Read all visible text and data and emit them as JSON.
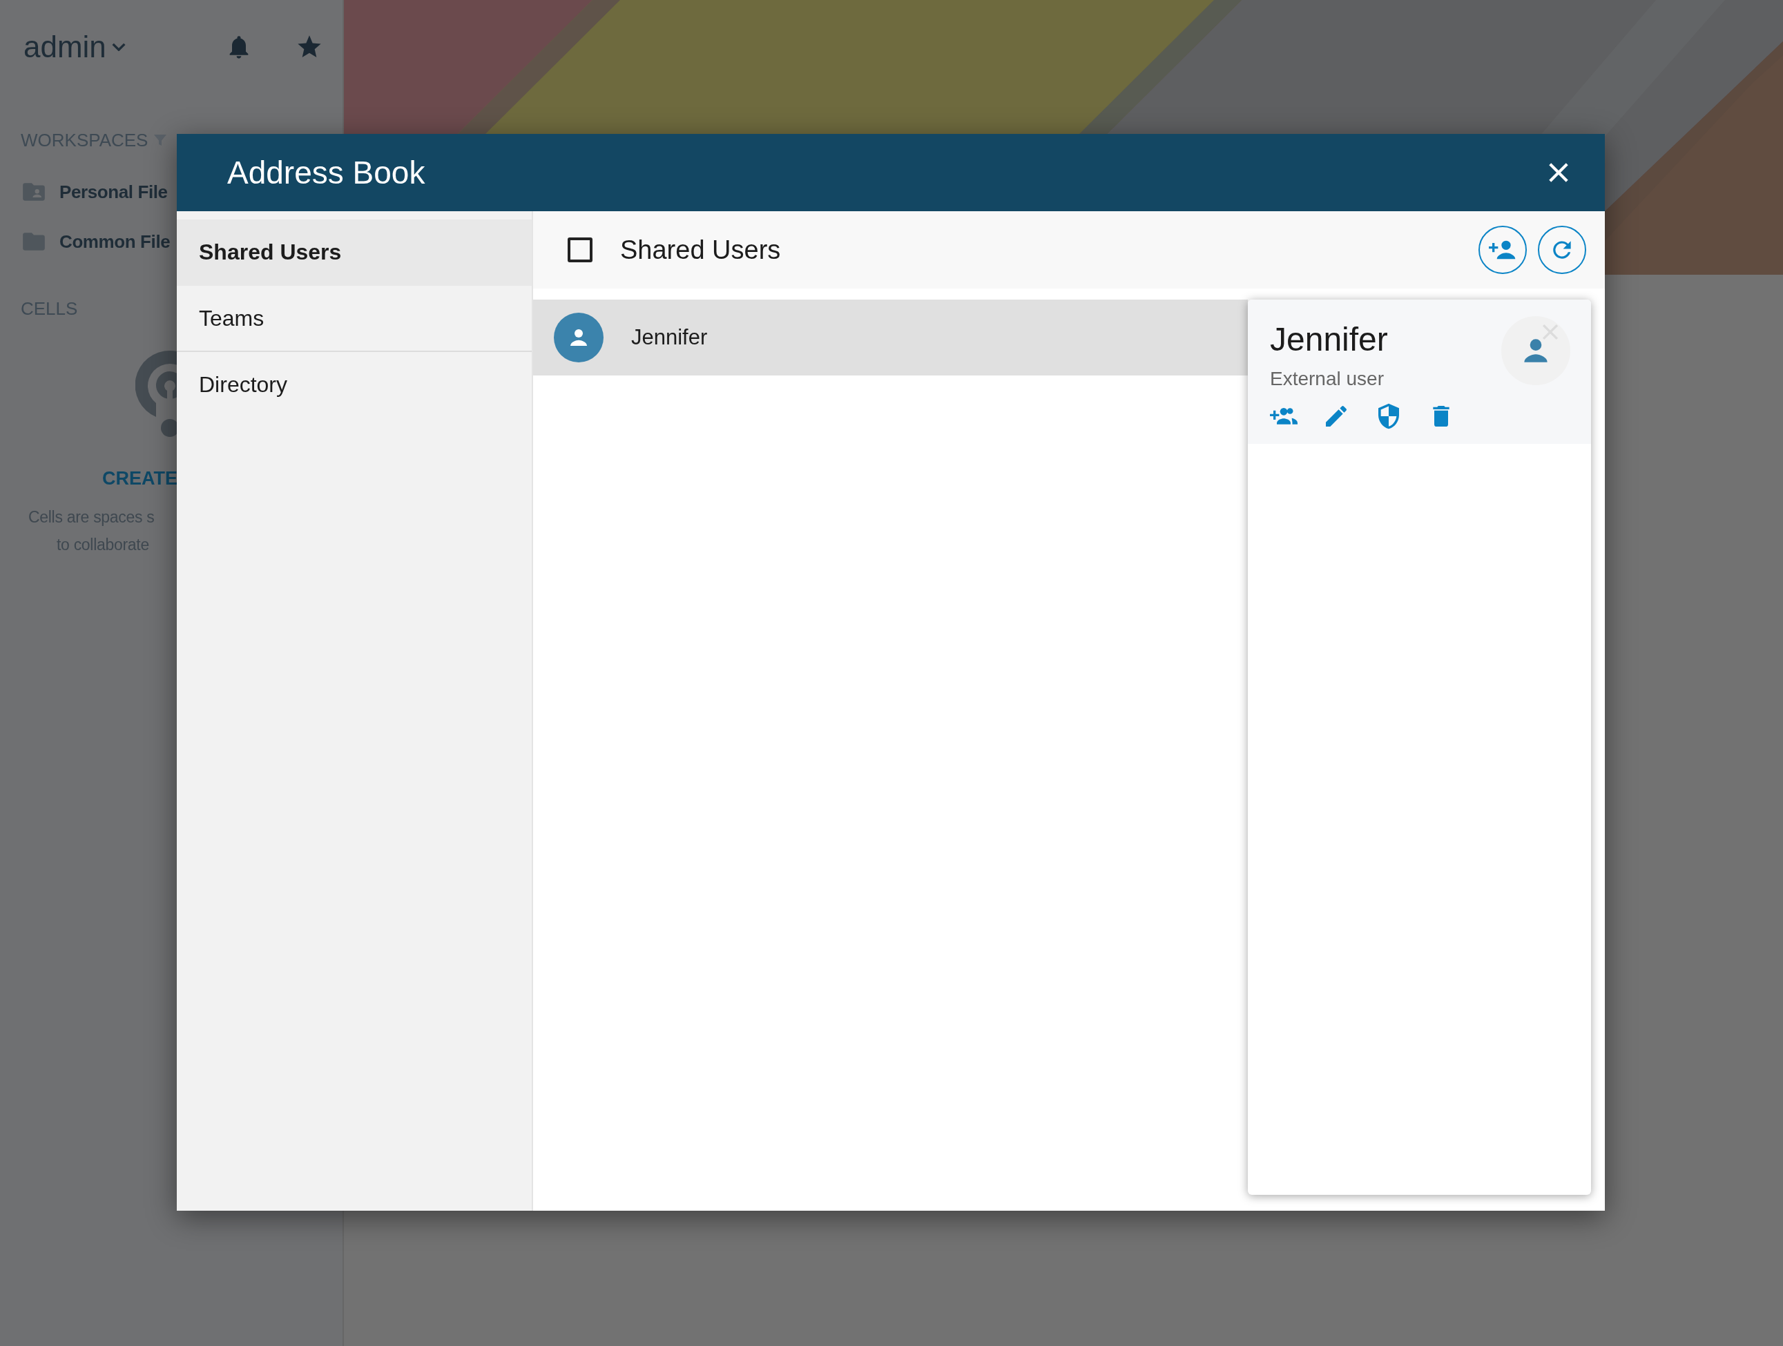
{
  "sidebar": {
    "user": "admin",
    "workspaces": {
      "title": "WORKSPACES",
      "items": [
        {
          "label": "Personal File",
          "kind": "personal"
        },
        {
          "label": "Common File",
          "kind": "common"
        }
      ]
    },
    "cells": {
      "title": "CELLS",
      "action": "CREATE",
      "lines": [
        "Cells are spaces s",
        "to collaborate"
      ]
    }
  },
  "dialog": {
    "title": "Address Book",
    "nav": [
      {
        "label": "Shared Users",
        "selected": true
      },
      {
        "label": "Teams",
        "selected": false
      },
      {
        "label": "Directory",
        "selected": false
      }
    ],
    "toolbar": {
      "title": "Shared Users",
      "checked": false
    },
    "rows": [
      {
        "name": "Jennifer",
        "selected": true
      }
    ],
    "card": {
      "name": "Jennifer",
      "subtitle": "External user"
    }
  }
}
